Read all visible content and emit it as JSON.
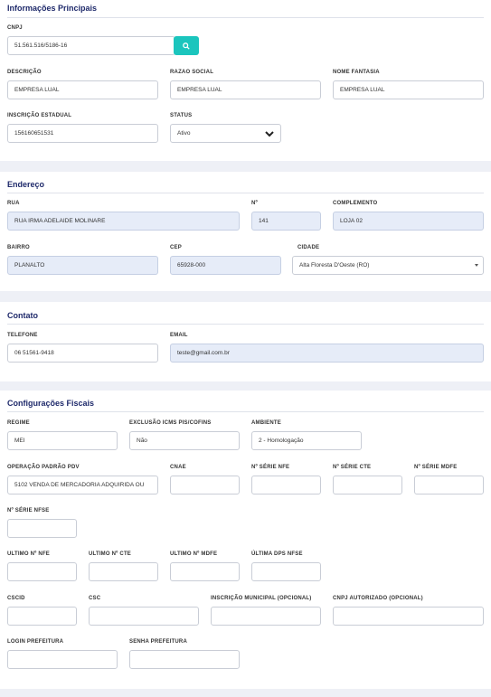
{
  "principais": {
    "title": "Informações Principais",
    "cnpj_label": "CNPJ",
    "cnpj_value": "51.561.516/5186-16",
    "descricao_label": "DESCRIÇÃO",
    "descricao_value": "EMPRESA LUAL",
    "razao_label": "RAZAO SOCIAL",
    "razao_value": "EMPRESA LUAL",
    "fantasia_label": "NOME FANTASIA",
    "fantasia_value": "EMPRESA LUAL",
    "ie_label": "INSCRIÇÃO ESTADUAL",
    "ie_value": "156160651531",
    "status_label": "STATUS",
    "status_value": "Ativo"
  },
  "endereco": {
    "title": "Endereço",
    "rua_label": "RUA",
    "rua_value": "RUA IRMA ADELAIDE MOLINARE",
    "num_label": "Nº",
    "num_value": "141",
    "compl_label": "COMPLEMENTO",
    "compl_value": "LOJA 02",
    "bairro_label": "BAIRRO",
    "bairro_value": "PLANALTO",
    "cep_label": "CEP",
    "cep_value": "65928-000",
    "cidade_label": "CIDADE",
    "cidade_value": "Alta Floresta D'Oeste (RO)"
  },
  "contato": {
    "title": "Contato",
    "tel_label": "TELEFONE",
    "tel_value": "06 51561-9418",
    "email_label": "EMAIL",
    "email_value": "teste@gmail.com.br"
  },
  "fiscais": {
    "title": "Configurações Fiscais",
    "regime_label": "REGIME",
    "regime_value": "MEI",
    "exclusao_label": "EXCLUSÃO ICMS PIS/COFINS",
    "exclusao_value": "Não",
    "ambiente_label": "AMBIENTE",
    "ambiente_value": "2 - Homologação",
    "operacao_label": "OPERAÇÃO PADRÃO PDV",
    "operacao_value": "5102 VENDA DE MERCADORIA ADQUIRIDA OU",
    "cnae_label": "CNAE",
    "serie_nfe_label": "Nº SÉRIE NFE",
    "serie_cte_label": "Nº SÉRIE CTE",
    "serie_mdfe_label": "Nº SÉRIE MDFE",
    "serie_nfse_label": "Nº SÉRIE NFSE",
    "ultimo_nfe_label": "ULTIMO Nº NFE",
    "ultimo_cte_label": "ULTIMO Nº CTE",
    "ultimo_mdfe_label": "ULTIMO Nº MDFE",
    "ultima_dps_label": "ÚLTIMA DPS NFSE",
    "cscid_label": "CSCID",
    "csc_label": "CSC",
    "im_label": "INSCRIÇÃO MUNICIPAL (OPCIONAL)",
    "cnpj_aut_label": "CNPJ AUTORIZADO (OPCIONAL)",
    "login_label": "LOGIN PREFEITURA",
    "senha_label": "SENHA PREFEITURA"
  },
  "icons": {
    "search": "search-icon",
    "chevron": "chevron-down-icon"
  },
  "colors": {
    "accent": "#1bc5bd",
    "title": "#1f2a6b",
    "readonly_bg": "#e6ecf8"
  }
}
